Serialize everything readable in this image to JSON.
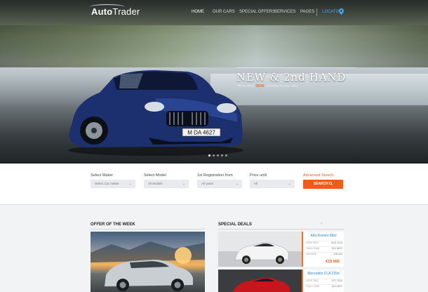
{
  "brand": {
    "logo_bold": "Auto",
    "logo_light": "Trader"
  },
  "nav": {
    "items": [
      {
        "label": "HOME",
        "active": true
      },
      {
        "label": "OUR CARS",
        "active": false
      },
      {
        "label": "SPECIAL OFFERS",
        "active": false
      },
      {
        "label": "SERVICES",
        "active": false
      },
      {
        "label": "PAGES",
        "active": false
      }
    ],
    "locator": "LOCATOR",
    "locator_icon": "map-pin-icon"
  },
  "hero": {
    "title": "NEW & 2nd HAND",
    "subtitle_prefix": "More than ",
    "subtitle_highlight": "3500",
    "subtitle_suffix": " vehicles in our offer",
    "plate": "M DA 4627",
    "slides": 5,
    "active_slide": 1
  },
  "search": {
    "fields": [
      {
        "label": "Select Maker",
        "value": "Select Car maker"
      },
      {
        "label": "Select Model",
        "value": "All Models"
      },
      {
        "label": "1st Registration from",
        "value": "All years"
      },
      {
        "label": "Price until",
        "value": "All"
      }
    ],
    "advanced_label": "Advanced Search",
    "button_label": "SEARCH",
    "button_icon": "search-icon"
  },
  "offer": {
    "title": "OFFER OF THE WEEK"
  },
  "deals": {
    "title": "SPECIAL DEALS",
    "items": [
      {
        "name": "Alfa Romeo Mito",
        "rows": [
          {
            "k": "FIRST REG",
            "v": "AUG 2013"
          },
          {
            "k": "FUEL CONS",
            "v": "30.6 MPG"
          },
          {
            "k": "MILEAGE",
            "v": "136 643"
          }
        ],
        "price": "€15 650"
      },
      {
        "name": "Mercedes CLA 220d",
        "rows": [
          {
            "k": "FIRST REG",
            "v": "OCT 2015"
          },
          {
            "k": "FUEL CONS",
            "v": "42.6 MPG"
          }
        ],
        "price": ""
      }
    ]
  },
  "colors": {
    "accent": "#f25b16",
    "link": "#2d8ad6",
    "car": "#1c2f6e"
  }
}
